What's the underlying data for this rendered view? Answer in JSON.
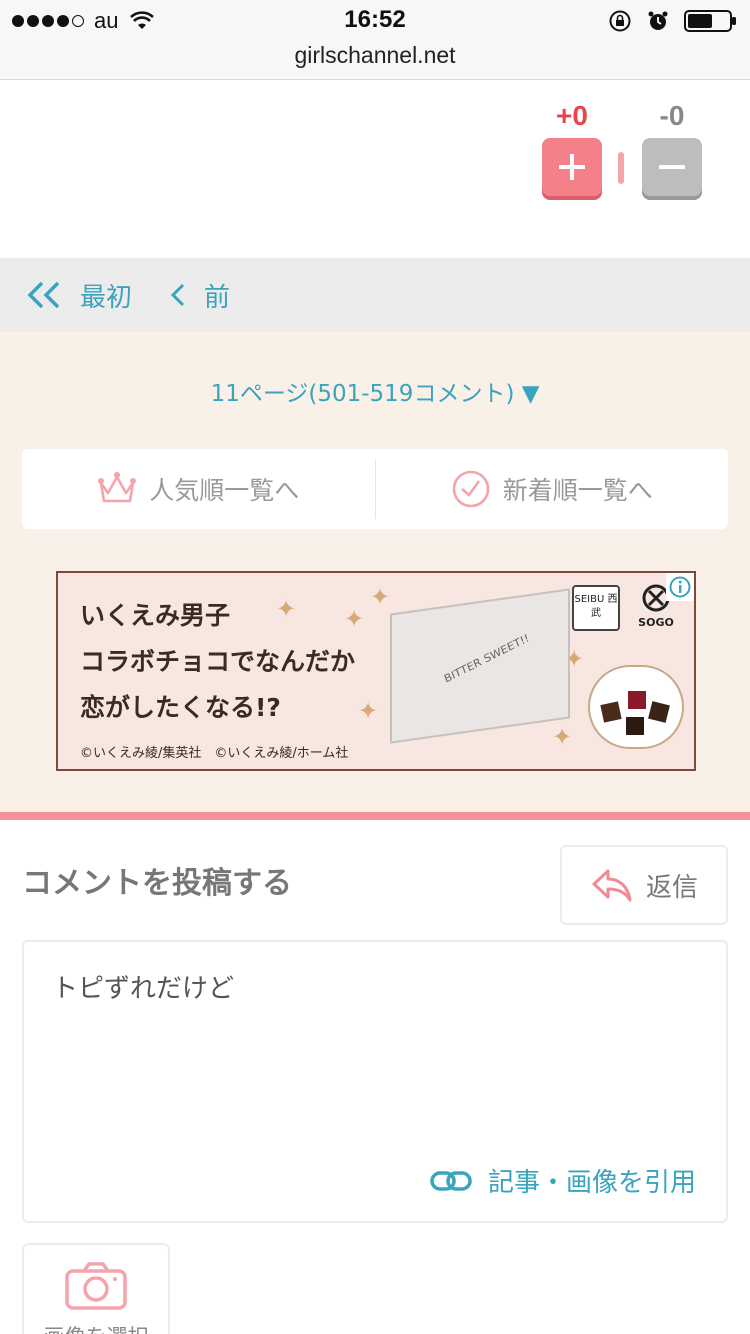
{
  "status_bar": {
    "carrier": "au",
    "time": "16:52",
    "url": "girlschannel.net"
  },
  "vote": {
    "plus_count": "+0",
    "minus_count": "-0"
  },
  "pager": {
    "first_label": "最初",
    "prev_label": "前"
  },
  "page_select": {
    "label": "11ページ(501-519コメント) ▼"
  },
  "sort": {
    "popular_label": "人気順一覧へ",
    "newest_label": "新着順一覧へ"
  },
  "ad": {
    "lines": [
      "いくえみ男子",
      "コラボチョコでなんだか",
      "恋がしたくなる!?"
    ],
    "copyright": "©いくえみ綾/集英社　©いくえみ綾/ホーム社",
    "logo_seibu": "SEIBU 西武",
    "logo_sogo": "SOGO",
    "package_text": "BITTER SWEET!!"
  },
  "comment": {
    "title": "コメントを投稿する",
    "reply_label": "返信",
    "text_value": "トピずれだけど",
    "quote_label": "記事・画像を引用",
    "photo_label": "画像を選択"
  },
  "colors": {
    "accent": "#3aa3bd",
    "pink": "#f4808a",
    "beige": "#f9f1e7",
    "plus_red": "#e8434f"
  }
}
